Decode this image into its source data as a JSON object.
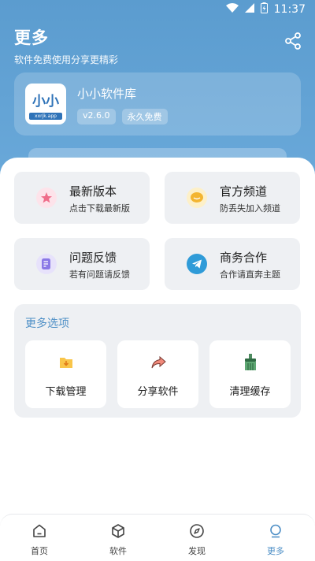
{
  "status_bar": {
    "time": "11:37"
  },
  "header": {
    "title": "更多",
    "subtitle": "软件免费使用分享更精彩"
  },
  "app": {
    "logo_text": "小小",
    "logo_strip": "xxrjk.app",
    "name": "小小软件库",
    "tags": [
      "v2.6.0",
      "永久免费"
    ]
  },
  "features": [
    {
      "title": "最新版本",
      "desc": "点击下载最新版",
      "icon": "star-icon",
      "color": "#ef6d8a"
    },
    {
      "title": "官方频道",
      "desc": "防丢失加入频道",
      "icon": "chat-bubble-icon",
      "color": "#f3b531"
    },
    {
      "title": "问题反馈",
      "desc": "若有问题请反馈",
      "icon": "feedback-icon",
      "color": "#8a78e6"
    },
    {
      "title": "商务合作",
      "desc": "合作请直奔主题",
      "icon": "telegram-icon",
      "color": "#2f9bd8"
    }
  ],
  "more": {
    "title": "更多选项",
    "options": [
      {
        "label": "下载管理",
        "icon": "download-folder-icon"
      },
      {
        "label": "分享软件",
        "icon": "share-arrow-icon"
      },
      {
        "label": "清理缓存",
        "icon": "broom-icon"
      }
    ]
  },
  "nav": {
    "items": [
      {
        "label": "首页",
        "icon": "home-icon"
      },
      {
        "label": "软件",
        "icon": "cube-icon"
      },
      {
        "label": "发现",
        "icon": "compass-icon"
      },
      {
        "label": "更多",
        "icon": "more-icon"
      }
    ],
    "active": "更多"
  },
  "colors": {
    "brand": "#5b9ccf",
    "accent": "#4e8fc6",
    "card_bg": "#eef0f3"
  }
}
